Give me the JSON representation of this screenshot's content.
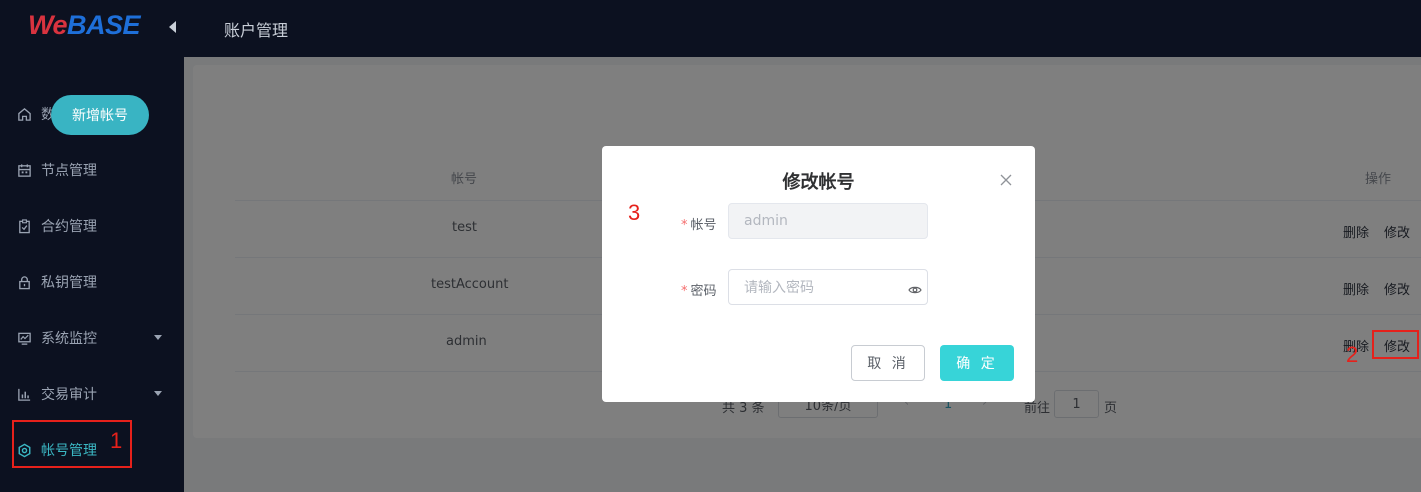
{
  "logo": {
    "we": "We",
    "base": "BASE"
  },
  "header": {
    "title": "账户管理"
  },
  "sidebar": {
    "items": [
      {
        "label": "数据概览",
        "icon": "home-icon"
      },
      {
        "label": "节点管理",
        "icon": "calendar-icon"
      },
      {
        "label": "合约管理",
        "icon": "clipboard-check-icon"
      },
      {
        "label": "私钥管理",
        "icon": "lock-icon"
      },
      {
        "label": "系统监控",
        "icon": "monitor-chart-icon",
        "has_submenu": true
      },
      {
        "label": "交易审计",
        "icon": "bar-chart-icon",
        "has_submenu": true
      },
      {
        "label": "帐号管理",
        "icon": "hexagon-icon",
        "active": true
      }
    ]
  },
  "annotations": {
    "n1": "1",
    "n2": "2",
    "n3": "3",
    "color": "#e6211b"
  },
  "main": {
    "add_button": "新增帐号",
    "columns": {
      "account": "帐号",
      "actions": "操作"
    },
    "rows": [
      {
        "account": "test",
        "delete": "删除",
        "edit": "修改"
      },
      {
        "account": "testAccount",
        "delete": "删除",
        "edit": "修改"
      },
      {
        "account": "admin",
        "delete": "删除",
        "edit": "修改"
      }
    ],
    "pagination": {
      "total": "共 3 条",
      "page_size": "10条/页",
      "current_page": "1",
      "goto_prefix": "前往",
      "goto_value": "1",
      "goto_suffix": "页"
    }
  },
  "dialog": {
    "title": "修改帐号",
    "account_label": "帐号",
    "account_value": "admin",
    "password_label": "密码",
    "password_placeholder": "请输入密码",
    "cancel": "取 消",
    "confirm": "确 定"
  },
  "colors": {
    "accent": "#39b4c3",
    "confirm": "#37d4d8",
    "sidebar_bg": "#0c1120",
    "required": "#f56c6c"
  }
}
